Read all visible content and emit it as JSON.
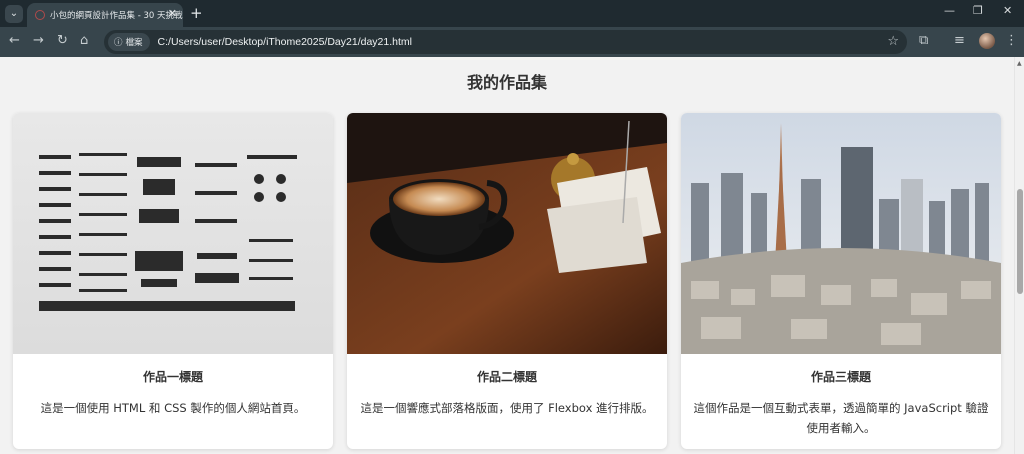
{
  "browser": {
    "tab_title": "小包的網頁設計作品集 - 30 天挑戰",
    "tab_close": "✕",
    "new_tab": "+",
    "site_info": "檔案",
    "url": "C:/Users/user/Desktop/iThome2025/Day21/day21.html"
  },
  "page": {
    "title": "我的作品集",
    "cards": [
      {
        "title": "作品一標題",
        "description": "這是一個使用 HTML 和 CSS 製作的個人網站首頁。"
      },
      {
        "title": "作品二標題",
        "description": "這是一個響應式部落格版面，使用了 Flexbox 進行排版。"
      },
      {
        "title": "作品三標題",
        "description": "這個作品是一個互動式表單，透過簡單的 JavaScript 驗證使用者輸入。"
      }
    ]
  }
}
